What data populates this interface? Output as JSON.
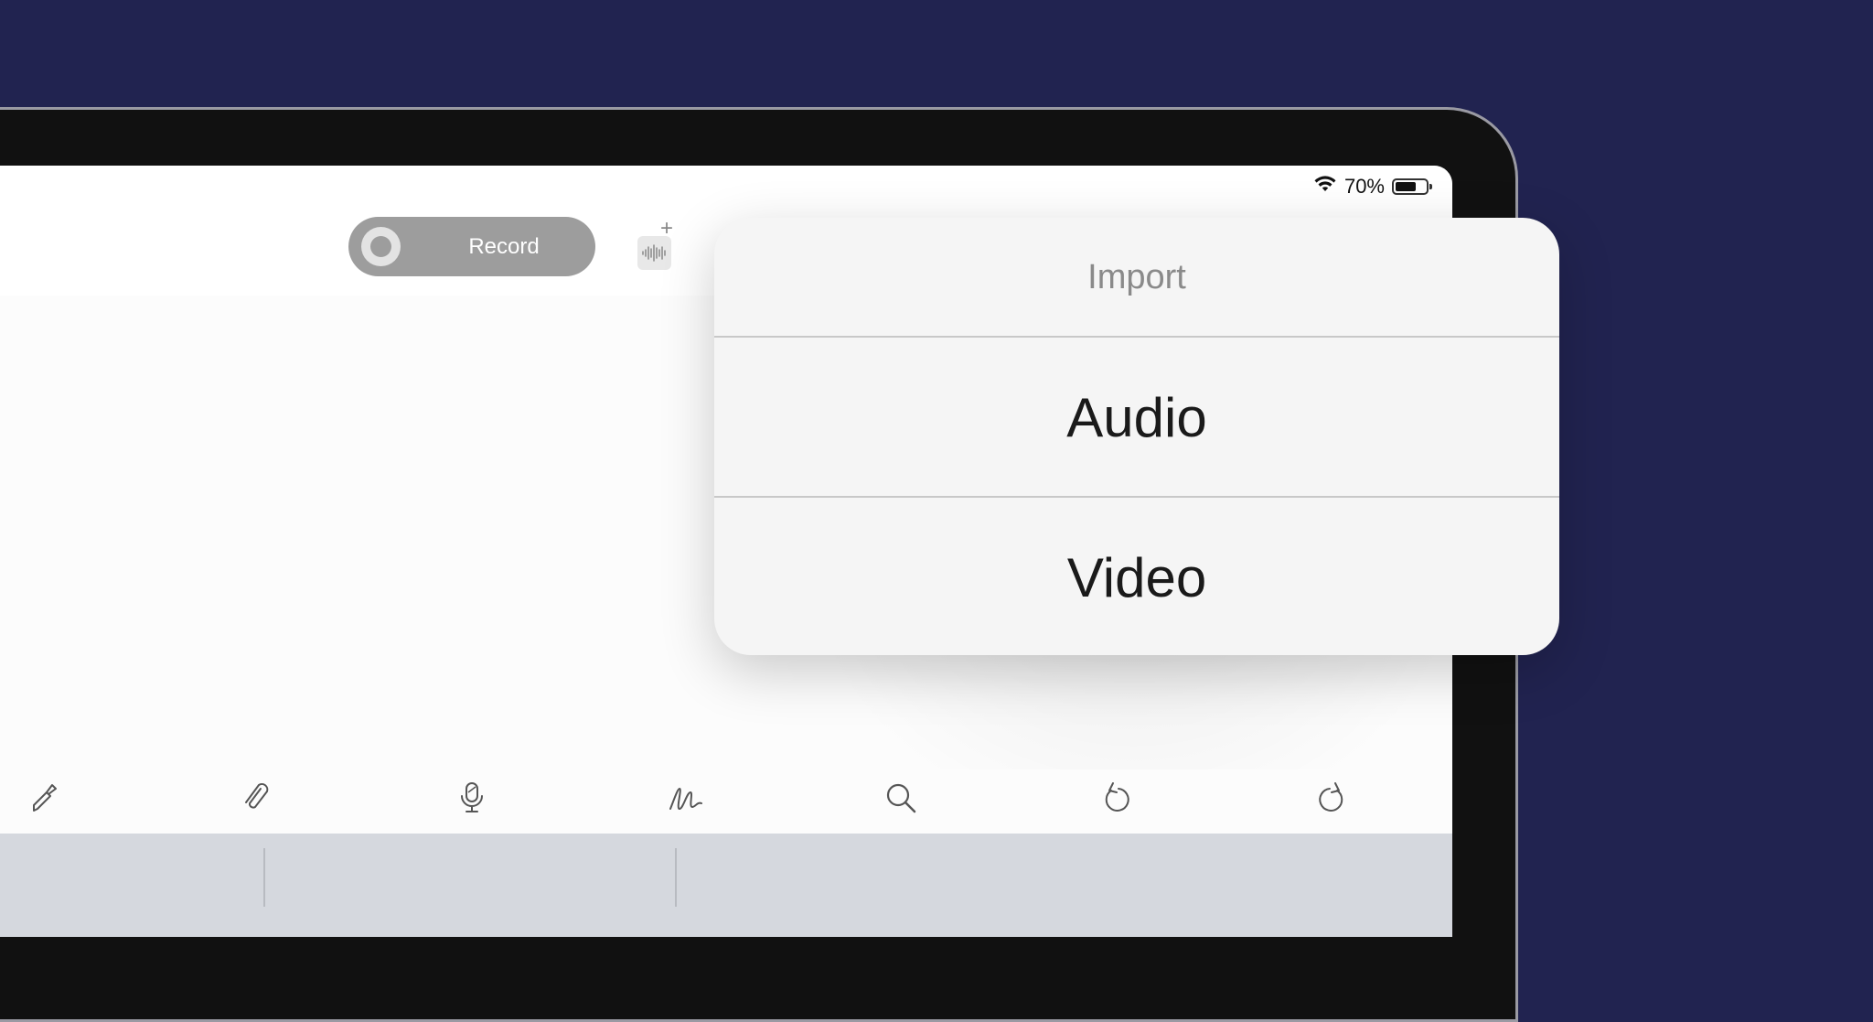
{
  "status_bar": {
    "battery_percent": "70%",
    "battery_level": 0.7
  },
  "toolbar_top": {
    "record_label": "Record"
  },
  "import_popover": {
    "title": "Import",
    "items": [
      {
        "label": "Audio"
      },
      {
        "label": "Video"
      }
    ]
  },
  "bottom_toolbar": {
    "tools": [
      "highlighter-icon",
      "paperclip-icon",
      "microphone-icon",
      "handwriting-icon",
      "search-icon",
      "undo-icon",
      "redo-icon"
    ]
  },
  "colors": {
    "background": "#212350",
    "record_button": "#9d9d9d",
    "popover_bg": "#f5f5f5",
    "keyboard_bg": "#d5d8de"
  }
}
